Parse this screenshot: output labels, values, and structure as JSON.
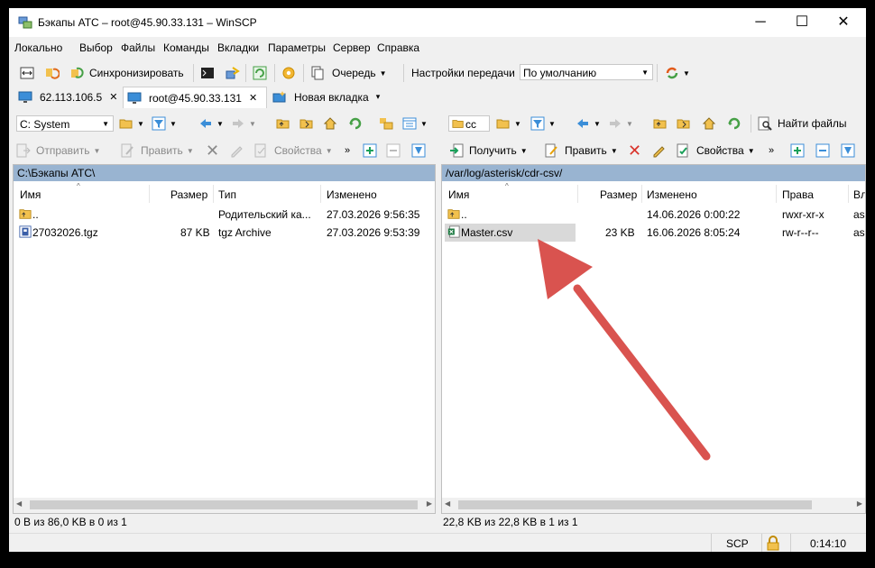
{
  "window": {
    "title": "Бэкапы АТС – root@45.90.33.131 – WinSCP",
    "minimize": "─",
    "maximize": "☐",
    "close": "✕"
  },
  "menu": [
    "Локально",
    "Выбор",
    "Файлы",
    "Команды",
    "Вкладки",
    "Параметры",
    "Сервер",
    "Справка"
  ],
  "toolbar": {
    "sync_label": "Синхронизировать",
    "queue_label": "Очередь",
    "transfer_settings_label": "Настройки передачи",
    "transfer_preset": "По умолчанию"
  },
  "tabs": [
    {
      "label": "62.113.106.5",
      "close": "✕"
    },
    {
      "label": "root@45.90.33.131",
      "close": "✕"
    },
    {
      "label": "Новая вкладка",
      "dropdown": "▾"
    }
  ],
  "left": {
    "drive": "C: System",
    "send_label": "Отправить",
    "edit_label": "Править",
    "props_label": "Свойства",
    "path": "C:\\Бэкапы АТС\\",
    "columns": [
      "Имя",
      "Размер",
      "Тип",
      "Изменено"
    ],
    "rows": [
      {
        "name": "..",
        "size": "",
        "type": "Родительский ка...",
        "modified": "27.03.2026 9:56:35",
        "icon": "parent-folder-icon"
      },
      {
        "name": "27032026.tgz",
        "size": "87 KB",
        "type": "tgz Archive",
        "modified": "27.03.2026 9:53:39",
        "icon": "archive-icon"
      }
    ],
    "status": "0 B из 86,0 KB в 0 из 1"
  },
  "right": {
    "path_combo": "cc",
    "find_label": "Найти файлы",
    "get_label": "Получить",
    "edit_label": "Править",
    "props_label": "Свойства",
    "path": "/var/log/asterisk/cdr-csv/",
    "columns": [
      "Имя",
      "Размер",
      "Изменено",
      "Права",
      "Вл"
    ],
    "rows": [
      {
        "name": "..",
        "size": "",
        "modified": "14.06.2026 0:00:22",
        "rights": "rwxr-xr-x",
        "owner": "as",
        "icon": "parent-folder-icon"
      },
      {
        "name": "Master.csv",
        "size": "23 KB",
        "modified": "16.06.2026 8:05:24",
        "rights": "rw-r--r--",
        "owner": "as",
        "icon": "csv-file-icon"
      }
    ],
    "status": "22,8 KB из 22,8 KB в 1 из 1"
  },
  "statusbar": {
    "protocol": "SCP",
    "time": "0:14:10"
  },
  "colors": {
    "path_bar": "#99b4d1",
    "selected_row": "#d9d9d9",
    "annotation_arrow": "#d9534f"
  }
}
